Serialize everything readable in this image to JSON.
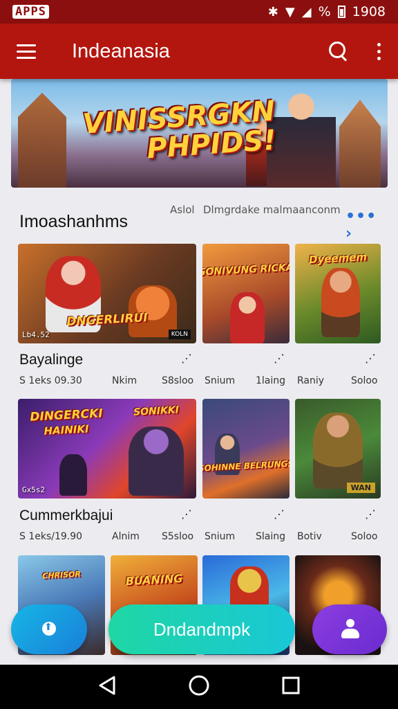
{
  "status_bar": {
    "left": "APPS",
    "signal": "⚡",
    "battery_pct": "%",
    "time": "1908"
  },
  "app_bar": {
    "title": "Indeanasia"
  },
  "banner": {
    "title_line1": "VINISSRGKN",
    "title_line2": "PHPIDS!"
  },
  "section": {
    "title": "Imoashanhms",
    "sub1": "Aslol",
    "sub2": "Dlmgrdake malmaanconm",
    "see_more": "•••"
  },
  "row1": {
    "title": "Bayalinge",
    "meta": [
      "S 1eks 09.30",
      "Nkim",
      "S8sloo",
      "Snium",
      "1laing",
      "Raniy",
      "Soloo"
    ],
    "thumbs": [
      {
        "label": "DNGERLIRUI",
        "cap": "Lb4.52",
        "badge": "KOLN"
      },
      {
        "label": "SONIVUNG RICKA",
        "cap": ""
      },
      {
        "label": "Dyeemem",
        "cap": ""
      }
    ]
  },
  "row2": {
    "title": "Cummerkbajui",
    "meta": [
      "S 1eks/19.90",
      "Alnim",
      "S5sloo",
      "Snium",
      "Slaing",
      "Botiv",
      "Soloo"
    ],
    "thumbs": [
      {
        "label": "DINGERCKI",
        "label2": "HAINIKI",
        "label3": "SONIKKI",
        "cap": "Gx5s2"
      },
      {
        "label": "SOHINNE BELRUNGS",
        "cap": ""
      },
      {
        "label": "WAN",
        "cap": ""
      }
    ]
  },
  "row3": {
    "thumbs": [
      {
        "label": "CHRISOR"
      },
      {
        "label": "BUANING"
      },
      {
        "label": ""
      },
      {
        "label": ""
      }
    ]
  },
  "fab": {
    "center_label": "Dndandmpk"
  },
  "colors": {
    "appbar": "#b3160f",
    "statusbar": "#8b0f0e",
    "accent_blue": "#2a6fd6",
    "fab_teal": "#1fd7a4",
    "fab_purple": "#7c36d8"
  }
}
